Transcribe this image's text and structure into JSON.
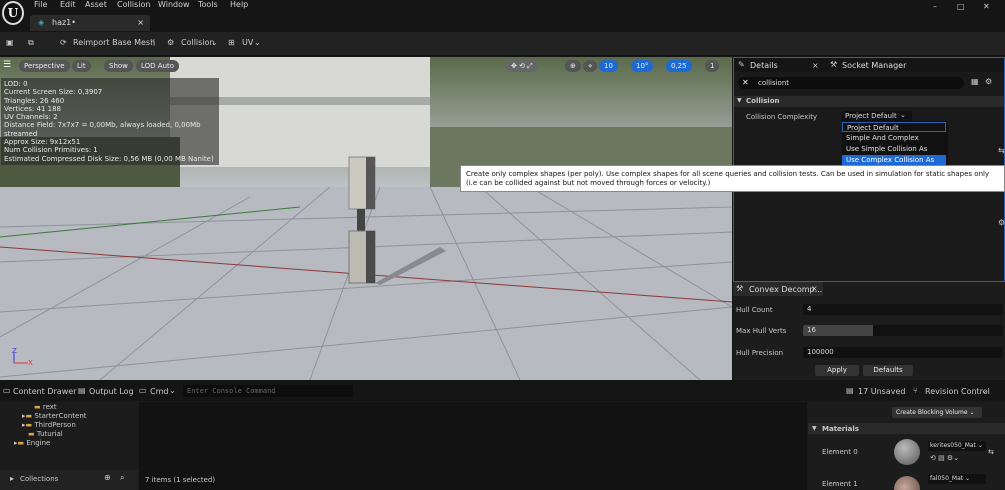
{
  "menu": [
    "File",
    "Edit",
    "Asset",
    "Collision",
    "Window",
    "Tools",
    "Help"
  ],
  "tab": {
    "title": "haz1•",
    "close": "×"
  },
  "toolbar": {
    "reimport": "Reimport Base Mesh",
    "collision": "Collision",
    "uv": "UV"
  },
  "window_controls": {
    "min": "–",
    "max": "□",
    "close": "✕"
  },
  "viewport": {
    "perspective": "Perspective",
    "lit": "Lit",
    "show": "Show",
    "lod_auto": "LOD Auto",
    "grid": "10",
    "angle": "10°",
    "scale": "0,25",
    "camera": "1",
    "stats": [
      "LOD: 0",
      "Current Screen Size: 0,3907",
      "Triangles: 26 460",
      "Vertices: 41 188",
      "UV Channels: 2",
      "Distance Field: 7x7x7 = 0,00Mb, always loaded, 0,00Mb streamed",
      "Approx Size: 9x12x51",
      "Num Collision Primitives: 1",
      "Estimated Compressed Disk Size: 0,56 MB (0,00 MB Nanite)"
    ],
    "axis_z": "Z",
    "axis_x": "X"
  },
  "details": {
    "tab": "Details",
    "tab2": "Socket Manager",
    "search": "collisiont",
    "section": "Collision",
    "label": "Collision Complexity",
    "value": "Project Default",
    "options": [
      "Project Default",
      "Simple And Complex",
      "Use Simple Collision As Complex",
      "Use Complex Collision As Simple"
    ]
  },
  "tooltip": "Create only complex shapes (per poly). Use complex shapes for all scene queries and collision tests. Can be used in simulation for static shapes only (i.e can be collided against but not moved through forces or velocity.)",
  "convex": {
    "title": "Convex Decomp...",
    "rows": [
      {
        "label": "Hull Count",
        "value": "4"
      },
      {
        "label": "Max Hull Verts",
        "value": "16"
      },
      {
        "label": "Hull Precision",
        "value": "100000"
      }
    ],
    "apply": "Apply",
    "defaults": "Defaults"
  },
  "bottom": {
    "content_drawer": "Content Drawer",
    "output_log": "Output Log",
    "cmd": "Cmd",
    "console_placeholder": "Enter Console Command",
    "unsaved": "17 Unsaved",
    "revision": "Revision Control",
    "tree": [
      "rext",
      "StarterContent",
      "ThirdPerson",
      "Tuturial",
      "Engine"
    ],
    "collections": "Collections",
    "items": "7 items (1 selected)",
    "blocking": "Create Blocking Volume",
    "materials": "Materials",
    "elements": [
      {
        "label": "Element 0",
        "mat": "kerites050_Mat"
      },
      {
        "label": "Element 1",
        "mat": "fal050_Mat"
      }
    ]
  }
}
